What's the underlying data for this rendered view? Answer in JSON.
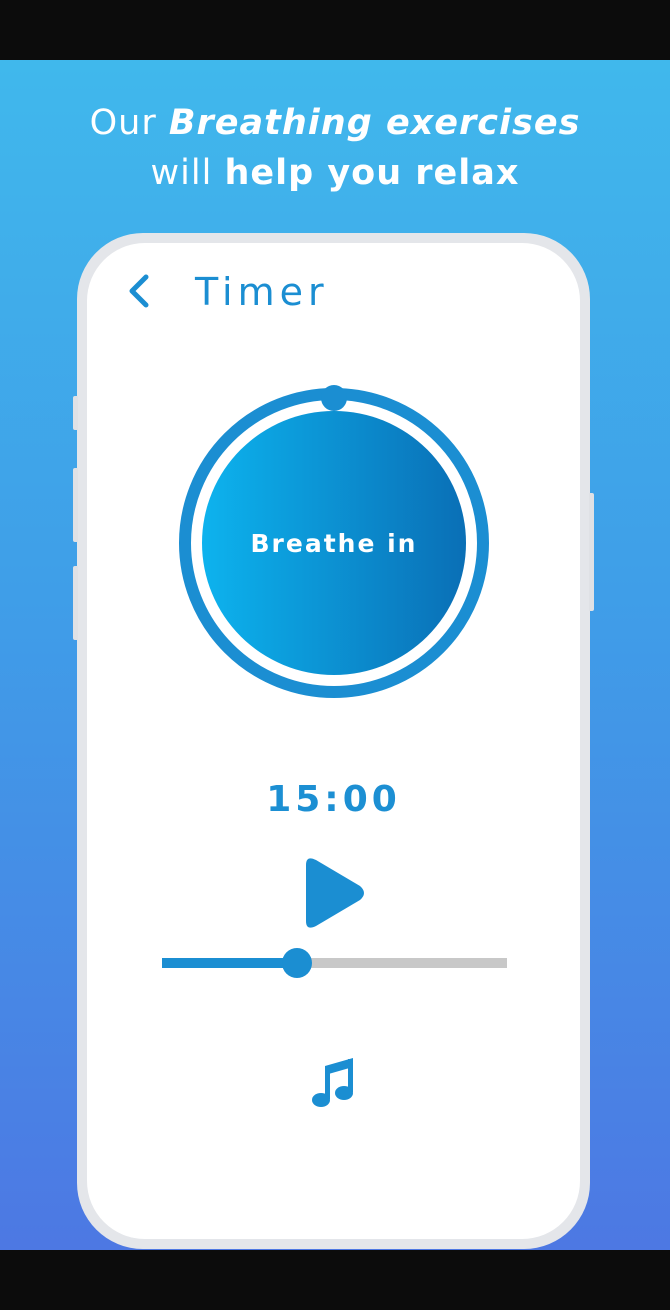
{
  "headline": {
    "line1_pre": "Our ",
    "line1_emph": "Breathing exercises",
    "line2_pre": "will ",
    "line2_bold": "help you relax"
  },
  "timer_screen": {
    "title": "Timer",
    "back_icon": "chevron-left-icon",
    "breath_label": "Breathe in",
    "time_display": "15:00",
    "play_icon": "play-icon",
    "progress_fraction": 0.39,
    "music_icon": "music-note-icon"
  },
  "colors": {
    "accent": "#1b8ed2",
    "background_top": "#40b8ec",
    "background_bottom": "#4d78e3",
    "track": "#c8c8c8"
  }
}
